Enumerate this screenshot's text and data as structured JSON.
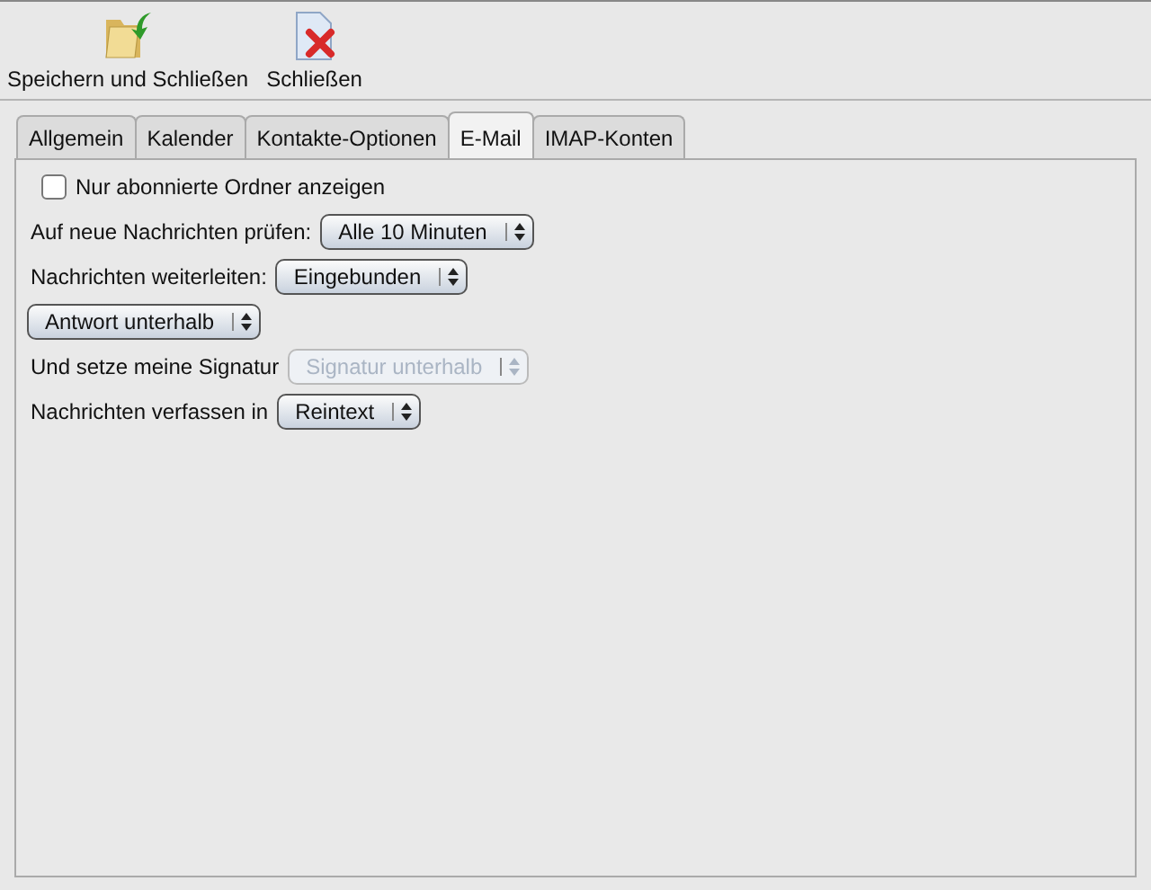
{
  "toolbar": [
    {
      "kind": "save",
      "label": "Speichern und Schließen"
    },
    {
      "kind": "close",
      "label": "Schließen"
    }
  ],
  "tabs": [
    {
      "label": "Allgemein",
      "selected": false
    },
    {
      "label": "Kalender",
      "selected": false
    },
    {
      "label": "Kontakte-Optionen",
      "selected": false
    },
    {
      "label": "E-Mail",
      "selected": true
    },
    {
      "label": "IMAP-Konten",
      "selected": false
    }
  ],
  "settings": [
    {
      "kind": "checkbox",
      "label": "Nur abonnierte Ordner anzeigen",
      "checked": false
    },
    {
      "kind": "select",
      "label": "Auf neue Nachrichten prüfen:",
      "value": "Alle 10 Minuten",
      "disabled": false
    },
    {
      "kind": "select",
      "label": "Nachrichten weiterleiten:",
      "value": "Eingebunden",
      "disabled": false
    },
    {
      "kind": "select",
      "value": "Antwort unterhalb",
      "disabled": false
    },
    {
      "kind": "select",
      "label": "Und setze meine Signatur",
      "value": "Signatur unterhalb",
      "disabled": true
    },
    {
      "kind": "select",
      "label": "Nachrichten verfassen in",
      "value": "Reintext",
      "disabled": false
    }
  ]
}
